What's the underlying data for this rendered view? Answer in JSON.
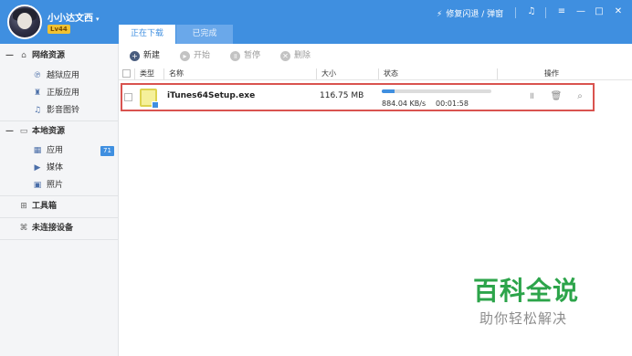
{
  "header": {
    "username": "小小达文西",
    "username_caret": "▾",
    "level": "Lv44",
    "fix_link": "修复闪退 / 弹窗",
    "icons": [
      "bolt-icon",
      "music-note-icon",
      "menu-icon",
      "minimize-icon",
      "maximize-icon",
      "close-icon"
    ],
    "icon_glyphs": {
      "bolt": "⚡",
      "music": "♫",
      "menu": "≡",
      "minimize": "—",
      "maximize": "□",
      "close": "✕"
    }
  },
  "tabs": [
    {
      "label": "正在下载",
      "active": true
    },
    {
      "label": "已完成",
      "active": false
    }
  ],
  "sidebar": {
    "sections": [
      {
        "label": "网络资源",
        "toggle": "—",
        "icon": "home-icon",
        "glyph": "⌂",
        "items": [
          {
            "label": "越狱应用",
            "icon": "jailbreak-app-icon",
            "glyph": "℗"
          },
          {
            "label": "正版应用",
            "icon": "genuine-app-icon",
            "glyph": "♜"
          },
          {
            "label": "影音图铃",
            "icon": "media-ringtone-icon",
            "glyph": "♫"
          }
        ]
      },
      {
        "label": "本地资源",
        "toggle": "—",
        "icon": "monitor-icon",
        "glyph": "▭",
        "items": [
          {
            "label": "应用",
            "icon": "apps-grid-icon",
            "glyph": "▦",
            "badge": "71"
          },
          {
            "label": "媒体",
            "icon": "video-camera-icon",
            "glyph": "▶"
          },
          {
            "label": "照片",
            "icon": "photo-icon",
            "glyph": "▣"
          }
        ]
      },
      {
        "label": "工具箱",
        "icon": "toolbox-icon",
        "glyph": "⊞"
      },
      {
        "label": "未连接设备",
        "icon": "device-icon",
        "glyph": "⌘"
      }
    ]
  },
  "toolbar": {
    "new": {
      "label": "新建",
      "glyph": "+"
    },
    "start": {
      "label": "开始",
      "glyph": "▸"
    },
    "pause": {
      "label": "暂停",
      "glyph": "॥"
    },
    "delete": {
      "label": "删除",
      "glyph": "✕"
    }
  },
  "table": {
    "columns": [
      "类型",
      "名称",
      "大小",
      "状态",
      "操作"
    ],
    "rows": [
      {
        "name": "iTunes64Setup.exe",
        "size": "116.75 MB",
        "progress": 0.12,
        "speed": "884.04 KB/s",
        "eta": "00:01:58",
        "actions": [
          {
            "name": "pause-icon",
            "glyph": "॥"
          },
          {
            "name": "trash-icon",
            "glyph": "🗑"
          },
          {
            "name": "magnifier-icon",
            "glyph": "⌕"
          }
        ]
      }
    ]
  },
  "watermark": {
    "title": "百科全说",
    "subtitle": "助你轻松解决"
  },
  "colors": {
    "brand_blue": "#3f8fe0",
    "highlight_red": "#d9534f",
    "watermark_green": "#2ca44a",
    "badge_yellow": "#f1c232"
  }
}
